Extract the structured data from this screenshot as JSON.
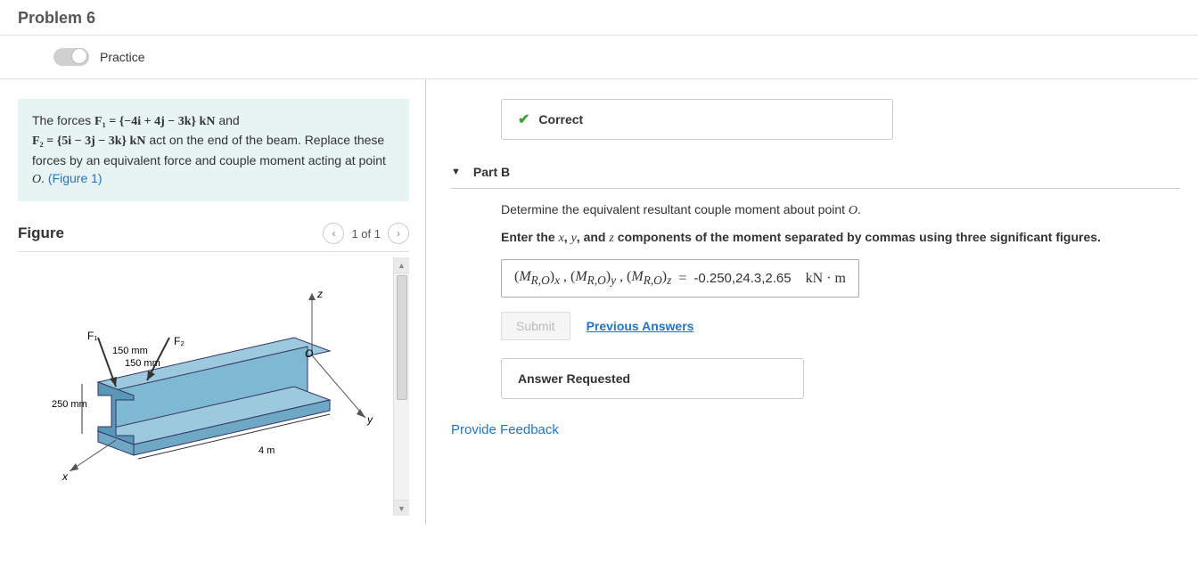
{
  "header": {
    "title": "Problem 6"
  },
  "practice": {
    "label": "Practice"
  },
  "problem": {
    "prefix": "The forces ",
    "f1_lhs": "F₁ = {−4i + 4j − 3k} kN",
    "mid1": " and",
    "f2_lhs": "F₂ = {5i − 3j − 3k} kN",
    "mid2": " act on the end of the beam. Replace these forces by an equivalent force and couple moment acting at point ",
    "pointO": "O",
    "suffix": ". ",
    "figlink": "(Figure 1)"
  },
  "figure": {
    "title": "Figure",
    "page": "1 of 1",
    "dims": {
      "h": "250 mm",
      "t1": "150 mm",
      "t2": "150 mm",
      "len": "4 m"
    },
    "labels": {
      "F1": "F₁",
      "F2": "F₂",
      "O": "O",
      "x": "x",
      "y": "y",
      "z": "z"
    }
  },
  "status": {
    "label": "Correct"
  },
  "partB": {
    "title": "Part B",
    "desc_pre": "Determine the equivalent resultant couple moment about point ",
    "desc_O": "O",
    "desc_post": ".",
    "instr_pre": "Enter the ",
    "ix": "x",
    "c1": ", ",
    "iy": "y",
    "c2": ", and ",
    "iz": "z",
    "instr_post": " components of the moment separated by commas using three significant figures.",
    "answer_lhs": "(M_{R,O})_x , (M_{R,O})_y , (M_{R,O})_z",
    "answer_val": "-0.250,24.3,2.65",
    "answer_unit": "kN · m",
    "submit": "Submit",
    "prev": "Previous Answers",
    "req": "Answer Requested"
  },
  "feedback": {
    "label": "Provide Feedback"
  }
}
